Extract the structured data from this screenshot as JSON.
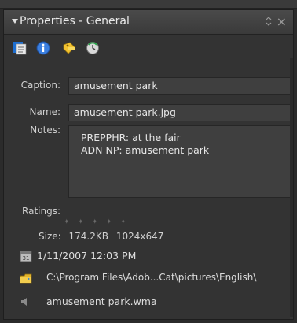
{
  "header": {
    "title": "Properties - General"
  },
  "toolbar": {
    "buttons": [
      "general-icon",
      "metadata-info-icon",
      "keywords-icon",
      "history-icon"
    ]
  },
  "fields": {
    "caption_label": "Caption:",
    "caption_value": "amusement park",
    "name_label": "Name:",
    "name_value": "amusement park.jpg",
    "notes_label": "Notes:",
    "notes_line1": "PREPPHR: at the fair",
    "notes_line2": "ADN NP: amusement park"
  },
  "ratings": {
    "label": "Ratings:",
    "stars": 5,
    "selected": 0
  },
  "size": {
    "label": "Size:",
    "file_size": "174.2KB",
    "dimensions": "1024x647"
  },
  "info": {
    "date": "1/11/2007 12:03 PM",
    "path": "C:\\Program Files\\Adob...Cat\\pictures\\English\\",
    "audio": "amusement park.wma"
  },
  "colors": {
    "panel_bg": "#333333",
    "field_bg": "#3f3f3f",
    "text": "#e6e6e6"
  }
}
